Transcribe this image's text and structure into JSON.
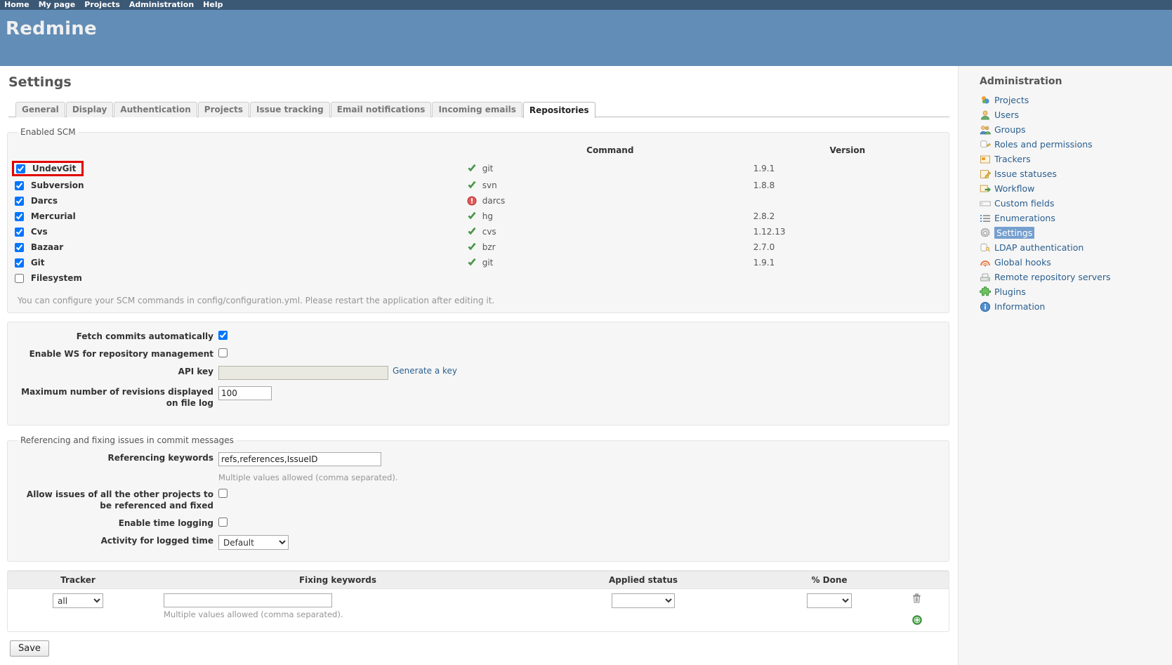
{
  "top_menu": [
    {
      "label": "Home"
    },
    {
      "label": "My page"
    },
    {
      "label": "Projects"
    },
    {
      "label": "Administration"
    },
    {
      "label": "Help"
    }
  ],
  "header": {
    "title": "Redmine"
  },
  "page": {
    "title": "Settings"
  },
  "tabs": [
    {
      "label": "General",
      "selected": false
    },
    {
      "label": "Display",
      "selected": false
    },
    {
      "label": "Authentication",
      "selected": false
    },
    {
      "label": "Projects",
      "selected": false
    },
    {
      "label": "Issue tracking",
      "selected": false
    },
    {
      "label": "Email notifications",
      "selected": false
    },
    {
      "label": "Incoming emails",
      "selected": false
    },
    {
      "label": "Repositories",
      "selected": true
    }
  ],
  "scm": {
    "legend": "Enabled SCM",
    "columns": {
      "command": "Command",
      "version": "Version"
    },
    "rows": [
      {
        "name": "UndevGit",
        "checked": true,
        "command": "git",
        "status": "ok",
        "version": "1.9.1",
        "highlighted": true
      },
      {
        "name": "Subversion",
        "checked": true,
        "command": "svn",
        "status": "ok",
        "version": "1.8.8",
        "highlighted": false
      },
      {
        "name": "Darcs",
        "checked": true,
        "command": "darcs",
        "status": "error",
        "version": "",
        "highlighted": false
      },
      {
        "name": "Mercurial",
        "checked": true,
        "command": "hg",
        "status": "ok",
        "version": "2.8.2",
        "highlighted": false
      },
      {
        "name": "Cvs",
        "checked": true,
        "command": "cvs",
        "status": "ok",
        "version": "1.12.13",
        "highlighted": false
      },
      {
        "name": "Bazaar",
        "checked": true,
        "command": "bzr",
        "status": "ok",
        "version": "2.7.0",
        "highlighted": false
      },
      {
        "name": "Git",
        "checked": true,
        "command": "git",
        "status": "ok",
        "version": "1.9.1",
        "highlighted": false
      },
      {
        "name": "Filesystem",
        "checked": false,
        "command": "",
        "status": "none",
        "version": "",
        "highlighted": false
      }
    ],
    "note": "You can configure your SCM commands in config/configuration.yml. Please restart the application after editing it."
  },
  "general": {
    "fetch_commits_label": "Fetch commits automatically",
    "fetch_commits_checked": true,
    "enable_ws_label": "Enable WS for repository management",
    "enable_ws_checked": false,
    "api_key_label": "API key",
    "api_key_value": "",
    "generate_key_link": "Generate a key",
    "max_revisions_label": "Maximum number of revisions displayed on file log",
    "max_revisions_value": "100"
  },
  "referencing": {
    "legend": "Referencing and fixing issues in commit messages",
    "referencing_keywords_label": "Referencing keywords",
    "referencing_keywords_value": "refs,references,IssueID",
    "referencing_keywords_hint": "Multiple values allowed (comma separated).",
    "allow_other_projects_label": "Allow issues of all the other projects to be referenced and fixed",
    "allow_other_projects_checked": false,
    "enable_time_logging_label": "Enable time logging",
    "enable_time_logging_checked": false,
    "activity_label": "Activity for logged time",
    "activity_value": "Default",
    "activity_options": [
      "Default"
    ]
  },
  "keyword_table": {
    "headers": [
      "Tracker",
      "Fixing keywords",
      "Applied status",
      "% Done"
    ],
    "rows": [
      {
        "tracker_value": "all",
        "tracker_options": [
          "all"
        ],
        "fixing_keywords_value": "",
        "fixing_keywords_hint": "Multiple values allowed (comma separated).",
        "applied_status_value": "",
        "applied_status_options": [
          ""
        ],
        "percent_done_value": "",
        "percent_done_options": [
          ""
        ],
        "delete_icon": "trash-icon"
      }
    ],
    "add_icon": "add-icon"
  },
  "actions": {
    "save_label": "Save"
  },
  "sidebar": {
    "title": "Administration",
    "items": [
      {
        "label": "Projects",
        "icon": "projects-icon",
        "current": false
      },
      {
        "label": "Users",
        "icon": "user-icon",
        "current": false
      },
      {
        "label": "Groups",
        "icon": "group-icon",
        "current": false
      },
      {
        "label": "Roles and permissions",
        "icon": "roles-icon",
        "current": false
      },
      {
        "label": "Trackers",
        "icon": "tracker-icon",
        "current": false
      },
      {
        "label": "Issue statuses",
        "icon": "status-icon",
        "current": false
      },
      {
        "label": "Workflow",
        "icon": "workflow-icon",
        "current": false
      },
      {
        "label": "Custom fields",
        "icon": "textfield-icon",
        "current": false
      },
      {
        "label": "Enumerations",
        "icon": "list-icon",
        "current": false
      },
      {
        "label": "Settings",
        "icon": "gear-icon",
        "current": true
      },
      {
        "label": "LDAP authentication",
        "icon": "ldap-icon",
        "current": false
      },
      {
        "label": "Global hooks",
        "icon": "hooks-icon",
        "current": false
      },
      {
        "label": "Remote repository servers",
        "icon": "server-icon",
        "current": false
      },
      {
        "label": "Plugins",
        "icon": "plugin-icon",
        "current": false
      },
      {
        "label": "Information",
        "icon": "info-icon",
        "current": false
      }
    ]
  },
  "colors": {
    "top_menu_bg": "#3b5875",
    "header_bg": "#628db6",
    "link": "#2a5f8f",
    "highlight_border": "#e10000",
    "ok_green": "#4ca64c",
    "error_red": "#d84a4a",
    "selected_sidebar": "#759fcf"
  }
}
